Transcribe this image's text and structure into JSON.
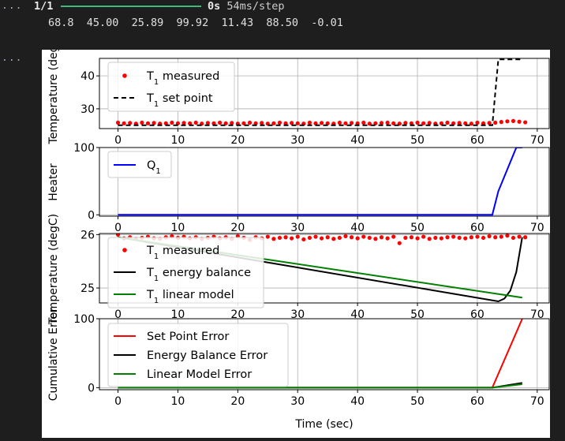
{
  "cell": {
    "gutter_top": "...",
    "gutter_output": "...",
    "progress": {
      "count": "1/1",
      "fraction": 1.0,
      "time": "0s",
      "rate": "54ms/step",
      "bar_color": "#3fb77d"
    },
    "values_line": "68.8  45.00  25.89  99.92  11.43  88.50  -0.01"
  },
  "chart_data": [
    {
      "type": "line",
      "ylabel": "Temperature (deg",
      "ylim": [
        24.0,
        45.3
      ],
      "yticks": [
        30,
        40
      ],
      "xticks": [
        0,
        10,
        20,
        30,
        40,
        50,
        60,
        70
      ],
      "legend": "top-left",
      "grid": true,
      "series": [
        {
          "name": "T₁ measured",
          "style": "red dots",
          "color": "#ff0000",
          "x": [
            0,
            1,
            2,
            3,
            4,
            5,
            6,
            7,
            8,
            9,
            10,
            11,
            12,
            13,
            14,
            15,
            16,
            17,
            18,
            19,
            20,
            21,
            22,
            23,
            24,
            25,
            26,
            27,
            28,
            29,
            30,
            31,
            32,
            33,
            34,
            35,
            36,
            37,
            38,
            39,
            40,
            41,
            42,
            43,
            44,
            45,
            46,
            47,
            48,
            49,
            50,
            51,
            52,
            53,
            54,
            55,
            56,
            57,
            58,
            59,
            60,
            61,
            62,
            63,
            64,
            65,
            66,
            67,
            68
          ],
          "y": [
            25.8,
            25.6,
            25.7,
            25.5,
            25.8,
            25.6,
            25.7,
            25.5,
            25.6,
            25.8,
            25.6,
            25.7,
            25.6,
            25.8,
            25.5,
            25.7,
            25.6,
            25.8,
            25.6,
            25.7,
            25.5,
            25.6,
            25.8,
            25.6,
            25.7,
            25.5,
            25.6,
            25.8,
            25.6,
            25.7,
            25.6,
            25.5,
            25.8,
            25.6,
            25.7,
            25.6,
            25.5,
            25.8,
            25.6,
            25.7,
            25.6,
            25.8,
            25.5,
            25.6,
            25.7,
            25.8,
            25.6,
            25.5,
            25.7,
            25.6,
            25.8,
            25.6,
            25.7,
            25.5,
            25.6,
            25.8,
            25.6,
            25.7,
            25.6,
            25.5,
            25.8,
            25.6,
            25.7,
            25.8,
            26.0,
            26.2,
            26.3,
            26.1,
            25.9
          ]
        },
        {
          "name": "T₁ set point",
          "style": "black dashed",
          "color": "#000000",
          "x": [
            0,
            62.5,
            63.5,
            67.5
          ],
          "y": [
            25.0,
            25.0,
            45.0,
            45.0
          ]
        }
      ]
    },
    {
      "type": "line",
      "ylabel": "Heater",
      "ylim": [
        -2,
        100
      ],
      "yticks": [
        0,
        100
      ],
      "xticks": [
        0,
        10,
        20,
        30,
        40,
        50,
        60,
        70
      ],
      "legend": "top-left",
      "grid": true,
      "series": [
        {
          "name": "Q₁",
          "color": "#0000ff",
          "x": [
            0,
            62.5,
            63.5,
            66.5,
            67.5
          ],
          "y": [
            0,
            0,
            35,
            100,
            100
          ]
        }
      ]
    },
    {
      "type": "line",
      "ylabel": "Temperature (degC)",
      "ylim": [
        24.72,
        26.02
      ],
      "yticks": [
        25,
        26
      ],
      "xticks": [
        0,
        10,
        20,
        30,
        40,
        50,
        60,
        70
      ],
      "legend": "top-left",
      "grid": true,
      "series": [
        {
          "name": "T₁ measured",
          "style": "red dots",
          "color": "#ff0000",
          "x": [
            0,
            1,
            2,
            3,
            4,
            5,
            6,
            7,
            8,
            9,
            10,
            11,
            12,
            13,
            14,
            15,
            16,
            17,
            18,
            19,
            20,
            21,
            22,
            23,
            24,
            25,
            26,
            27,
            28,
            29,
            30,
            31,
            32,
            33,
            34,
            35,
            36,
            37,
            38,
            39,
            40,
            41,
            42,
            43,
            44,
            45,
            46,
            47,
            48,
            49,
            50,
            51,
            52,
            53,
            54,
            55,
            56,
            57,
            58,
            59,
            60,
            61,
            62,
            63,
            64,
            65,
            66,
            67,
            68
          ],
          "y": [
            26.0,
            25.93,
            25.95,
            25.92,
            25.94,
            25.96,
            25.93,
            25.92,
            25.95,
            25.97,
            25.94,
            25.96,
            25.93,
            25.95,
            25.92,
            25.94,
            25.96,
            25.93,
            25.95,
            25.92,
            25.97,
            25.94,
            25.9,
            25.95,
            25.93,
            25.96,
            25.92,
            25.94,
            25.95,
            25.93,
            25.96,
            25.91,
            25.94,
            25.96,
            25.93,
            25.95,
            25.92,
            25.94,
            25.97,
            25.95,
            25.93,
            25.96,
            25.94,
            25.92,
            25.95,
            25.93,
            25.96,
            25.84,
            25.94,
            25.95,
            25.93,
            25.96,
            25.92,
            25.94,
            25.93,
            25.95,
            25.96,
            25.94,
            25.93,
            25.95,
            25.96,
            25.94,
            25.97,
            25.95,
            25.96,
            25.98,
            25.94,
            25.96,
            25.95
          ]
        },
        {
          "name": "T₁ energy balance",
          "color": "#000000",
          "x": [
            0,
            63.5,
            64.5,
            65.5,
            66.5,
            67.5
          ],
          "y": [
            25.95,
            24.75,
            24.8,
            24.95,
            25.3,
            25.95
          ]
        },
        {
          "name": "T₁ linear model",
          "color": "#008000",
          "x": [
            0,
            67.5
          ],
          "y": [
            25.95,
            24.82
          ]
        }
      ]
    },
    {
      "type": "line",
      "ylabel": "Cumulative Error",
      "xlabel": "Time (sec)",
      "ylim": [
        -3,
        100
      ],
      "yticks": [
        0,
        100
      ],
      "xticks": [
        0,
        10,
        20,
        30,
        40,
        50,
        60,
        70
      ],
      "legend": "top-left",
      "grid": true,
      "series": [
        {
          "name": "Set Point Error",
          "color": "#ff0000",
          "x": [
            0,
            62.5,
            67.5
          ],
          "y": [
            0,
            0,
            99.9
          ]
        },
        {
          "name": "Energy Balance Error",
          "color": "#000000",
          "x": [
            0,
            62.5,
            67.5
          ],
          "y": [
            0,
            0,
            7
          ]
        },
        {
          "name": "Linear Model Error",
          "color": "#008000",
          "x": [
            0,
            62.5,
            67.5
          ],
          "y": [
            0,
            0,
            5
          ]
        }
      ]
    }
  ]
}
